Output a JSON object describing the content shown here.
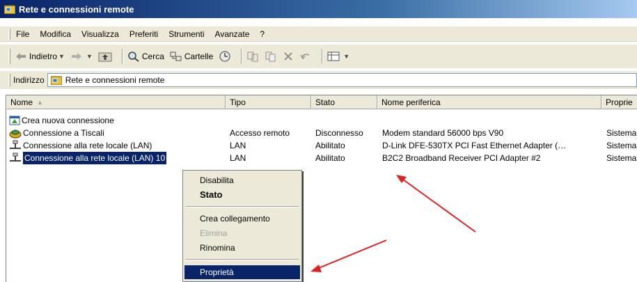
{
  "window": {
    "title": "Rete e connessioni remote"
  },
  "menubar": {
    "items": [
      "File",
      "Modifica",
      "Visualizza",
      "Preferiti",
      "Strumenti",
      "Avanzate",
      "?"
    ]
  },
  "toolbar": {
    "back_label": "Indietro",
    "search_label": "Cerca",
    "folders_label": "Cartelle"
  },
  "address": {
    "label": "Indirizzo",
    "value": "Rete e connessioni remote"
  },
  "list": {
    "columns": [
      "Nome",
      "Tipo",
      "Stato",
      "Nome periferica",
      "Proprie"
    ],
    "rows": [
      {
        "name": "Crea nuova connessione",
        "type": "",
        "status": "",
        "device": "",
        "owner": "",
        "icon": "new-connection-icon"
      },
      {
        "name": "Connessione a Tiscali",
        "type": "Accesso remoto",
        "status": "Disconnesso",
        "device": "Modem standard 56000 bps V90",
        "owner": "Sistema",
        "icon": "dialup-icon"
      },
      {
        "name": "Connessione alla rete locale (LAN)",
        "type": "LAN",
        "status": "Abilitato",
        "device": "D-Link DFE-530TX PCI Fast Ethernet Adapter (…",
        "owner": "Sistema",
        "icon": "lan-icon"
      },
      {
        "name": "Connessione alla rete locale (LAN) 10",
        "type": "LAN",
        "status": "Abilitato",
        "device": "B2C2 Broadband Receiver PCI Adapter #2",
        "owner": "Sistema",
        "icon": "lan-icon"
      }
    ]
  },
  "context_menu": {
    "disable": "Disabilita",
    "status": "Stato",
    "create_shortcut": "Crea collegamento",
    "delete": "Elimina",
    "rename": "Rinomina",
    "properties": "Proprietà"
  },
  "colors": {
    "title_bar": "#0a246a",
    "selection": "#0a246a",
    "annotation_arrow": "#e02020",
    "chrome": "#ece9d8"
  }
}
